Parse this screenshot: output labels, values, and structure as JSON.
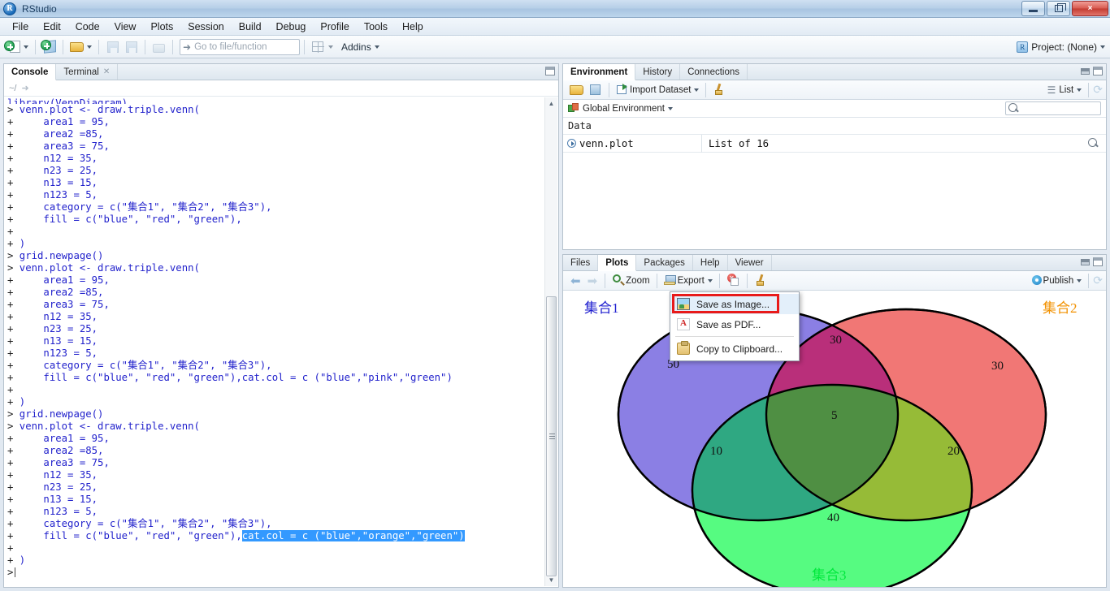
{
  "window": {
    "title": "RStudio",
    "app_icon": "R",
    "minimize": "minimize-icon",
    "restore": "restore-icon",
    "close": "×"
  },
  "menubar": [
    "File",
    "Edit",
    "Code",
    "View",
    "Plots",
    "Session",
    "Build",
    "Debug",
    "Profile",
    "Tools",
    "Help"
  ],
  "toolbar": {
    "goto_placeholder": "Go to file/function",
    "addins_label": "Addins",
    "project_label": "Project: (None)"
  },
  "console": {
    "tabs": [
      {
        "label": "Console",
        "active": true,
        "closable": false
      },
      {
        "label": "Terminal",
        "active": false,
        "closable": true
      }
    ],
    "path": "~/",
    "lines": [
      {
        "p": "",
        "t": "library(VennDiagram)",
        "clip": true
      },
      {
        "p": ">",
        "t": " venn.plot <- draw.triple.venn("
      },
      {
        "p": "+",
        "t": "     area1 = 95,"
      },
      {
        "p": "+",
        "t": "     area2 =85,"
      },
      {
        "p": "+",
        "t": "     area3 = 75,"
      },
      {
        "p": "+",
        "t": "     n12 = 35,"
      },
      {
        "p": "+",
        "t": "     n23 = 25,"
      },
      {
        "p": "+",
        "t": "     n13 = 15,"
      },
      {
        "p": "+",
        "t": "     n123 = 5,"
      },
      {
        "p": "+",
        "t": "     category = c(\"集合1\", \"集合2\", \"集合3\"),"
      },
      {
        "p": "+",
        "t": "     fill = c(\"blue\", \"red\", \"green\"),"
      },
      {
        "p": "+",
        "t": ""
      },
      {
        "p": "+",
        "t": " )"
      },
      {
        "p": ">",
        "t": " grid.newpage()"
      },
      {
        "p": ">",
        "t": " venn.plot <- draw.triple.venn("
      },
      {
        "p": "+",
        "t": "     area1 = 95,"
      },
      {
        "p": "+",
        "t": "     area2 =85,"
      },
      {
        "p": "+",
        "t": "     area3 = 75,"
      },
      {
        "p": "+",
        "t": "     n12 = 35,"
      },
      {
        "p": "+",
        "t": "     n23 = 25,"
      },
      {
        "p": "+",
        "t": "     n13 = 15,"
      },
      {
        "p": "+",
        "t": "     n123 = 5,"
      },
      {
        "p": "+",
        "t": "     category = c(\"集合1\", \"集合2\", \"集合3\"),"
      },
      {
        "p": "+",
        "t": "     fill = c(\"blue\", \"red\", \"green\"),cat.col = c (\"blue\",\"pink\",\"green\")"
      },
      {
        "p": "+",
        "t": ""
      },
      {
        "p": "+",
        "t": " )"
      },
      {
        "p": ">",
        "t": " grid.newpage()"
      },
      {
        "p": ">",
        "t": " venn.plot <- draw.triple.venn("
      },
      {
        "p": "+",
        "t": "     area1 = 95,"
      },
      {
        "p": "+",
        "t": "     area2 =85,"
      },
      {
        "p": "+",
        "t": "     area3 = 75,"
      },
      {
        "p": "+",
        "t": "     n12 = 35,"
      },
      {
        "p": "+",
        "t": "     n23 = 25,"
      },
      {
        "p": "+",
        "t": "     n13 = 15,"
      },
      {
        "p": "+",
        "t": "     n123 = 5,"
      },
      {
        "p": "+",
        "t": "     category = c(\"集合1\", \"集合2\", \"集合3\"),"
      },
      {
        "p": "+",
        "t": "     fill = c(\"blue\", \"red\", \"green\"),",
        "sel": "cat.col = c (\"blue\",\"orange\",\"green\")"
      },
      {
        "p": "+",
        "t": ""
      },
      {
        "p": "+",
        "t": " )"
      },
      {
        "p": ">",
        "t": "",
        "cursor": true
      }
    ]
  },
  "environment": {
    "tabs": [
      {
        "label": "Environment",
        "active": true
      },
      {
        "label": "History",
        "active": false
      },
      {
        "label": "Connections",
        "active": false
      }
    ],
    "import_label": "Import Dataset",
    "view_label": "List",
    "scope_label": "Global Environment",
    "search_placeholder": "",
    "section_label": "Data",
    "rows": [
      {
        "name": "venn.plot",
        "value": "List of 16"
      }
    ]
  },
  "plots": {
    "tabs": [
      {
        "label": "Files",
        "active": false
      },
      {
        "label": "Plots",
        "active": true
      },
      {
        "label": "Packages",
        "active": false
      },
      {
        "label": "Help",
        "active": false
      },
      {
        "label": "Viewer",
        "active": false
      }
    ],
    "zoom_label": "Zoom",
    "export_label": "Export",
    "publish_label": "Publish"
  },
  "context_menu": {
    "items": [
      {
        "label": "Save as Image...",
        "icon": "image-icon",
        "highlighted": true
      },
      {
        "label": "Save as PDF...",
        "icon": "pdf-icon",
        "highlighted": false
      },
      {
        "label": "Copy to Clipboard...",
        "icon": "clipboard-icon",
        "highlighted": false
      }
    ],
    "highlight_border_color": "#e81a1a"
  },
  "chart_data": {
    "type": "venn",
    "title": "",
    "sets": [
      {
        "name": "集合1",
        "area": 95,
        "fill": "#6a5bdc",
        "label_color": "#1e1ecf",
        "label_position": "top-left"
      },
      {
        "name": "集合2",
        "area": 85,
        "fill": "#f0706e",
        "label_color": "#f29100",
        "label_position": "top-right"
      },
      {
        "name": "集合3",
        "area": 75,
        "fill": "#4dfb7a",
        "label_color": "#00e83c",
        "label_position": "bottom-center"
      }
    ],
    "regions": [
      {
        "label": "50",
        "sets": [
          "集合1"
        ],
        "value": 50
      },
      {
        "label": "30",
        "sets": [
          "集合2"
        ],
        "value": 30
      },
      {
        "label": "40",
        "sets": [
          "集合3"
        ],
        "value": 40
      },
      {
        "label": "30",
        "sets": [
          "集合1",
          "集合2"
        ],
        "value": 30
      },
      {
        "label": "10",
        "sets": [
          "集合1",
          "集合3"
        ],
        "value": 10
      },
      {
        "label": "20",
        "sets": [
          "集合2",
          "集合3"
        ],
        "value": 20
      },
      {
        "label": "5",
        "sets": [
          "集合1",
          "集合2",
          "集合3"
        ],
        "value": 5
      }
    ],
    "intersections": {
      "n12": 35,
      "n23": 25,
      "n13": 15,
      "n123": 5
    }
  }
}
